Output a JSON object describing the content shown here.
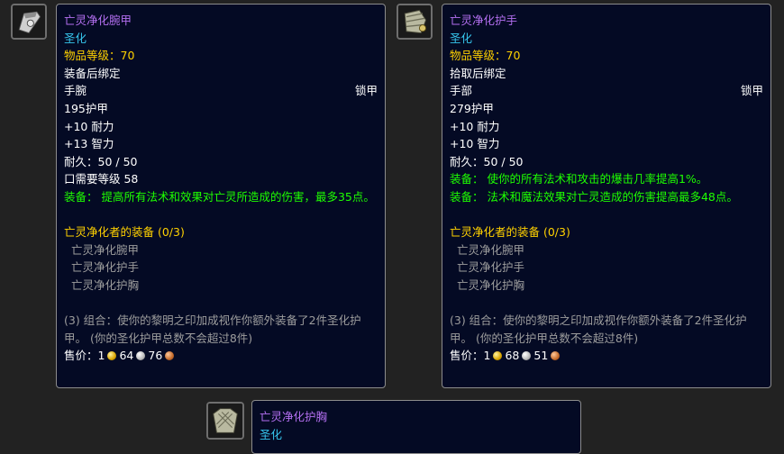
{
  "tooltips": [
    {
      "name": "亡灵净化腕甲",
      "quality": "圣化",
      "item_level": "物品等级：70",
      "binding": "装备后绑定",
      "slot": "手腕",
      "armor_type": "锁甲",
      "armor": "195护甲",
      "stats": [
        "+10 耐力",
        "+13 智力"
      ],
      "durability": "耐久：50 / 50",
      "requirement": "口需要等级 58",
      "equip_effects": [
        "装备： 提高所有法术和效果对亡灵所造成的伤害，最多35点。"
      ],
      "set_name": "亡灵净化者的装备 (0/3)",
      "set_items": [
        "亡灵净化腕甲",
        "亡灵净化护手",
        "亡灵净化护胸"
      ],
      "set_bonus": "(3) 组合：使你的黎明之印加成视作你额外装备了2件圣化护甲。 (你的圣化护甲总数不会超过8件)",
      "sell_label": "售价：",
      "sell_gold": "1",
      "sell_silver": "64",
      "sell_copper": "76",
      "icon": "bracer-icon"
    },
    {
      "name": "亡灵净化护手",
      "quality": "圣化",
      "item_level": "物品等级：70",
      "binding": "拾取后绑定",
      "slot": "手部",
      "armor_type": "锁甲",
      "armor": "279护甲",
      "stats": [
        "+10 耐力",
        "+10 智力"
      ],
      "durability": "耐久：50 / 50",
      "equip_effects": [
        "装备： 使你的所有法术和攻击的爆击几率提高1%。",
        "装备： 法术和魔法效果对亡灵造成的伤害提高最多48点。"
      ],
      "set_name": "亡灵净化者的装备 (0/3)",
      "set_items": [
        "亡灵净化腕甲",
        "亡灵净化护手",
        "亡灵净化护胸"
      ],
      "set_bonus": "(3) 组合：使你的黎明之印加成视作你额外装备了2件圣化护甲。 (你的圣化护甲总数不会超过8件)",
      "sell_label": "售价：",
      "sell_gold": "1",
      "sell_silver": "68",
      "sell_copper": "51",
      "icon": "gauntlets-icon"
    },
    {
      "name": "亡灵净化护胸",
      "quality": "圣化",
      "icon": "chest-armor-icon"
    }
  ],
  "colors": {
    "epic_name": "#b36ff0",
    "quality": "#37c7ee",
    "item_level": "#ffd100",
    "equip_effect": "#1eff00",
    "set_name": "#ffd100",
    "set_item": "#9d9d9d",
    "tooltip_bg": "#040a24"
  }
}
